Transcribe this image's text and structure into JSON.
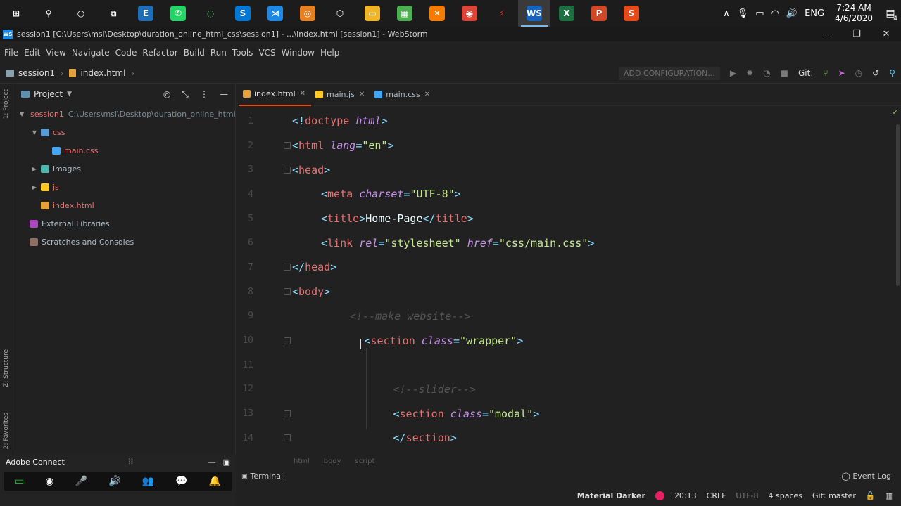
{
  "taskbar": {
    "icons": [
      {
        "name": "windows-start-icon",
        "glyph": "⊞",
        "color": "#ffffff",
        "bg": "transparent"
      },
      {
        "name": "search-icon",
        "glyph": "⚲",
        "color": "#ffffff",
        "bg": "transparent"
      },
      {
        "name": "cortana-icon",
        "glyph": "○",
        "color": "#ffffff",
        "bg": "transparent"
      },
      {
        "name": "task-view-icon",
        "glyph": "⧉",
        "color": "#ffffff",
        "bg": "transparent"
      },
      {
        "name": "app-e-icon",
        "glyph": "E",
        "color": "#ffffff",
        "bg": "#1e6fb8"
      },
      {
        "name": "whatsapp-icon",
        "glyph": "✆",
        "color": "#ffffff",
        "bg": "#25d366"
      },
      {
        "name": "app-green-ring-icon",
        "glyph": "◌",
        "color": "#2ecc40",
        "bg": "transparent"
      },
      {
        "name": "skype-icon",
        "glyph": "S",
        "color": "#ffffff",
        "bg": "#0078d7"
      },
      {
        "name": "vscode-icon",
        "glyph": "⋊",
        "color": "#ffffff",
        "bg": "#1e88e5"
      },
      {
        "name": "app-orange-icon",
        "glyph": "◎",
        "color": "#ffffff",
        "bg": "#e67e22"
      },
      {
        "name": "app-cube-icon",
        "glyph": "⬡",
        "color": "#ffffff",
        "bg": "transparent"
      },
      {
        "name": "file-explorer-icon",
        "glyph": "▭",
        "color": "#ffffff",
        "bg": "#f0b429"
      },
      {
        "name": "app-multicolor-icon",
        "glyph": "▦",
        "color": "#ffffff",
        "bg": "#4caf50"
      },
      {
        "name": "xampp-icon",
        "glyph": "✕",
        "color": "#ffffff",
        "bg": "#f57c00"
      },
      {
        "name": "chrome-icon",
        "glyph": "◉",
        "color": "#ffffff",
        "bg": "#db4437"
      },
      {
        "name": "app-lightning-icon",
        "glyph": "⚡",
        "color": "#e53935",
        "bg": "transparent"
      },
      {
        "name": "webstorm-icon",
        "glyph": "WS",
        "color": "#ffffff",
        "bg": "#1565c0",
        "active": true
      },
      {
        "name": "excel-icon",
        "glyph": "X",
        "color": "#ffffff",
        "bg": "#1d6f42"
      },
      {
        "name": "powerpoint-icon",
        "glyph": "P",
        "color": "#ffffff",
        "bg": "#d24726"
      },
      {
        "name": "app-s-icon",
        "glyph": "S",
        "color": "#ffffff",
        "bg": "#e64a19"
      }
    ],
    "tray": {
      "lang": "ENG",
      "time": "7:24 AM",
      "date": "4/6/2020",
      "notification_count": "4"
    }
  },
  "titlebar": {
    "title": "session1 [C:\\Users\\msi\\Desktop\\duration_online_html_css\\session1] - ...\\index.html [session1] - WebStorm"
  },
  "menu": [
    "File",
    "Edit",
    "View",
    "Navigate",
    "Code",
    "Refactor",
    "Build",
    "Run",
    "Tools",
    "VCS",
    "Window",
    "Help"
  ],
  "nav": {
    "project": "session1",
    "file": "index.html",
    "add_config": "ADD CONFIGURATION...",
    "git_label": "Git:"
  },
  "sidebar_labels": {
    "project": "1: Project",
    "structure": "Z: Structure",
    "favorites": "2: Favorites"
  },
  "project_panel": {
    "title": "Project",
    "tree": [
      {
        "label": "session1",
        "extra": "C:\\Users\\msi\\Desktop\\duration_online_html_c",
        "indent": 0,
        "arrow": "▼",
        "icon": "folder",
        "color": "#e57373"
      },
      {
        "label": "css",
        "indent": 1,
        "arrow": "▼",
        "icon": "folder-blue",
        "color": "#e57373"
      },
      {
        "label": "main.css",
        "indent": 2,
        "arrow": "",
        "icon": "css",
        "color": "#e57373"
      },
      {
        "label": "images",
        "indent": 1,
        "arrow": "▶",
        "icon": "folder-teal",
        "color": "#b0bec5"
      },
      {
        "label": "js",
        "indent": 1,
        "arrow": "▶",
        "icon": "folder-yellow",
        "color": "#e57373"
      },
      {
        "label": "index.html",
        "indent": 1,
        "arrow": "",
        "icon": "html",
        "color": "#e57373"
      },
      {
        "label": "External Libraries",
        "indent": 0,
        "arrow": "",
        "icon": "library",
        "color": "#b0bec5"
      },
      {
        "label": "Scratches and Consoles",
        "indent": 0,
        "arrow": "",
        "icon": "scratch",
        "color": "#b0bec5"
      }
    ]
  },
  "tabs": [
    {
      "label": "index.html",
      "icon": "html",
      "active": true
    },
    {
      "label": "main.js",
      "icon": "js",
      "active": false
    },
    {
      "label": "main.css",
      "icon": "css",
      "active": false
    }
  ],
  "code_lines": [
    {
      "num": "1",
      "indent": 0,
      "fold": false,
      "tokens": [
        [
          "t-punc",
          "<!"
        ],
        [
          "t-doc",
          "doctype "
        ],
        [
          "t-attr",
          "html"
        ],
        [
          "t-punc",
          ">"
        ]
      ]
    },
    {
      "num": "2",
      "indent": 0,
      "fold": true,
      "tokens": [
        [
          "t-punc",
          "<"
        ],
        [
          "t-tag",
          "html "
        ],
        [
          "t-attr",
          "lang"
        ],
        [
          "t-punc",
          "="
        ],
        [
          "t-str",
          "\"en\""
        ],
        [
          "t-punc",
          ">"
        ]
      ]
    },
    {
      "num": "3",
      "indent": 0,
      "fold": true,
      "tokens": [
        [
          "t-punc",
          "<"
        ],
        [
          "t-tag",
          "head"
        ],
        [
          "t-punc",
          ">"
        ]
      ]
    },
    {
      "num": "4",
      "indent": 1,
      "fold": false,
      "tokens": [
        [
          "t-punc",
          "<"
        ],
        [
          "t-tag",
          "meta "
        ],
        [
          "t-attr",
          "charset"
        ],
        [
          "t-punc",
          "="
        ],
        [
          "t-str",
          "\"UTF-8\""
        ],
        [
          "t-punc",
          ">"
        ]
      ]
    },
    {
      "num": "5",
      "indent": 1,
      "fold": false,
      "tokens": [
        [
          "t-punc",
          "<"
        ],
        [
          "t-tag",
          "title"
        ],
        [
          "t-punc",
          ">"
        ],
        [
          "t-txt",
          "Home-Page"
        ],
        [
          "t-punc",
          "</"
        ],
        [
          "t-tag",
          "title"
        ],
        [
          "t-punc",
          ">"
        ]
      ]
    },
    {
      "num": "6",
      "indent": 1,
      "fold": false,
      "tokens": [
        [
          "t-punc",
          "<"
        ],
        [
          "t-tag",
          "link "
        ],
        [
          "t-attr",
          "rel"
        ],
        [
          "t-punc",
          "="
        ],
        [
          "t-str",
          "\"stylesheet\" "
        ],
        [
          "t-attr",
          "href"
        ],
        [
          "t-punc",
          "="
        ],
        [
          "t-str",
          "\"css/main.css\""
        ],
        [
          "t-punc",
          ">"
        ]
      ]
    },
    {
      "num": "7",
      "indent": 0,
      "fold": true,
      "tokens": [
        [
          "t-punc",
          "</"
        ],
        [
          "t-tag",
          "head"
        ],
        [
          "t-punc",
          ">"
        ]
      ]
    },
    {
      "num": "8",
      "indent": 0,
      "fold": true,
      "tokens": [
        [
          "t-punc",
          "<"
        ],
        [
          "t-tag",
          "body"
        ],
        [
          "t-punc",
          ">"
        ]
      ]
    },
    {
      "num": "9",
      "indent": 2,
      "fold": false,
      "tokens": [
        [
          "t-cmt",
          "<!--make website-->"
        ]
      ]
    },
    {
      "num": "10",
      "indent": 2.5,
      "fold": true,
      "tokens": [
        [
          "t-punc",
          "<"
        ],
        [
          "t-tag",
          "section "
        ],
        [
          "t-attr",
          "class"
        ],
        [
          "t-punc",
          "="
        ],
        [
          "t-str",
          "\"wrapper\""
        ],
        [
          "t-punc",
          ">"
        ]
      ]
    },
    {
      "num": "11",
      "indent": 0,
      "fold": false,
      "tokens": []
    },
    {
      "num": "12",
      "indent": 3.5,
      "fold": false,
      "tokens": [
        [
          "t-cmt",
          "<!--slider-->"
        ]
      ]
    },
    {
      "num": "13",
      "indent": 3.5,
      "fold": true,
      "tokens": [
        [
          "t-punc",
          "<"
        ],
        [
          "t-tag",
          "section "
        ],
        [
          "t-attr",
          "class"
        ],
        [
          "t-punc",
          "="
        ],
        [
          "t-str",
          "\"modal\""
        ],
        [
          "t-punc",
          ">"
        ]
      ]
    },
    {
      "num": "14",
      "indent": 3.5,
      "fold": true,
      "tokens": [
        [
          "t-punc",
          "</"
        ],
        [
          "t-tag",
          "section"
        ],
        [
          "t-punc",
          ">"
        ]
      ]
    }
  ],
  "breadcrumb": [
    "html",
    "body",
    "script"
  ],
  "bottom": {
    "terminal": "Terminal",
    "event_log": "Event Log"
  },
  "status": {
    "theme": "Material Darker",
    "position": "20:13",
    "line_sep": "CRLF",
    "encoding": "UTF-8",
    "indent": "4 spaces",
    "git": "Git: master"
  },
  "adobe": {
    "title": "Adobe Connect"
  }
}
